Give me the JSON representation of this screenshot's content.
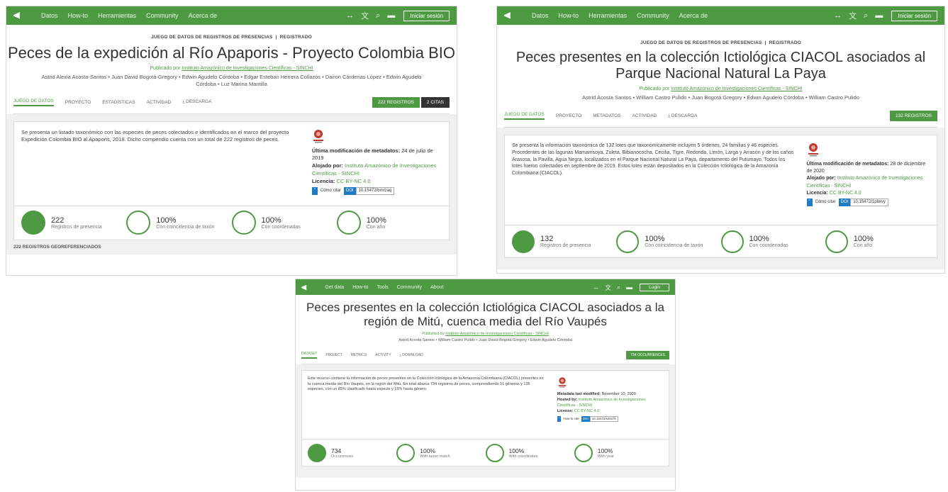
{
  "colors": {
    "brand_green": "#4e9a43",
    "doi_blue": "#1f7bc2"
  },
  "icons": [
    "bird-logo-icon",
    "pulse-icon",
    "translate-icon",
    "search-icon",
    "chat-icon",
    "download-icon",
    "institution-logo-icon"
  ],
  "p1": {
    "nav": [
      "Datos",
      "How-to",
      "Herramientas",
      "Community",
      "Acerca de"
    ],
    "login": "Iniciar sesión",
    "kicker": "JUEGO DE DATOS DE REGISTROS DE PRESENCIAS",
    "kicker2": "REGISTRADO",
    "title": "Peces de la expedición al Río Apaporis - Proyecto Colombia BIO",
    "published_by": "Publicado por",
    "publisher": "Instituto Amazónico de Investigaciones Científicas - SINCHI",
    "authors": "Astrid Alexia Acosta-Santos • Juan David Bogotá-Gregory • Edwin Agudelo Córdoba • Edgar Esteban Herrera Collazos • Dairon Cárdenas López • Edwin Agudelo Córdoba • Luz Marina Mantilla",
    "tabs": [
      "JUEGO DE DATOS",
      "PROYECTO",
      "ESTADÍSTICAS",
      "ACTIVIDAD",
      "DESCARGA"
    ],
    "btn_records_num": "222",
    "btn_records": "REGISTROS",
    "btn_cites": "2 CITAS",
    "description": "Se presenta un listado taxonómico con las especies de peces colectados e identificados en el marco del proyecto Expedición Colombia BIO al Apaporis, 2018. Dicho compendio cuenta con un total de 222 registros de peces.",
    "meta_mod_label": "Última modificación de metadatos:",
    "meta_mod_value": "24 de julio de 2019",
    "meta_host_label": "Alojado por:",
    "meta_host_value": "Instituto Amazónico de Investigaciones Científicas - SINCHI",
    "meta_lic_label": "Licencia:",
    "meta_lic_value": "CC BY-NC 4.0",
    "cite": "Cómo citar",
    "doi": "DOI",
    "doi_value": "10.15472/bmrzaq",
    "stats": [
      {
        "num": "222",
        "label": "Registros de presencia",
        "fraction": 1
      },
      {
        "num": "100%",
        "label": "Con coincidencia de taxón",
        "fraction": 0
      },
      {
        "num": "100%",
        "label": "Con coordenadas",
        "fraction": 0
      },
      {
        "num": "100%",
        "label": "Con año",
        "fraction": 0
      }
    ],
    "footer": "222 REGISTROS GEOREFERENCIADOS"
  },
  "p2": {
    "nav": [
      "Datos",
      "How-to",
      "Herramientas",
      "Community",
      "Acerca de"
    ],
    "login": "Iniciar sesión",
    "kicker": "JUEGO DE DATOS DE REGISTROS DE PRESENCIAS",
    "kicker2": "REGISTRADO",
    "title": "Peces presentes en la colección Ictiológica CIACOL asociados al Parque Nacional Natural La Paya",
    "published_by": "Publicado por",
    "publisher": "Instituto Amazónico de Investigaciones Científicas - SINCHI",
    "authors": "Astrid Acosta Santos • William Castro Pulido • Juan Bogotá Gregory • Edwin Agudelo Córdoba • William Castro Pulido",
    "tabs": [
      "JUEGO DE DATOS",
      "PROYECTO",
      "METADATOS",
      "ACTIVIDAD",
      "DESCARGA"
    ],
    "btn_records_num": "132",
    "btn_records": "REGISTROS",
    "description": "Se presenta la información taxonómica de 132 lotes que taxonómicamente incluyen 5 órdenes, 24 familias y 46 especies. Procedentes de las lagunas Mamamsoya, Zuleta, Bibianococha, Cecilia, Tigre, Redonda, Limón, Larga y Arrasón y de los caños Arasosa, la Pavilla, Agua Negra, localizados en el Parque Nacional Natural La Paya, departamento del Putumayo. Todos los lotes fueron colectados en septiembre de 2019. Estos lotes están depositados en la Colección Ictiológica de la Amazonía Colombiana (CIACOL).",
    "meta_mod_label": "Última modificación de metadatos:",
    "meta_mod_value": "28 de diciembre de 2020",
    "meta_host_label": "Alojado por:",
    "meta_host_value": "Instituto Amazónico de Investigaciones Científicas - SINCHI",
    "meta_lic_label": "Licencia:",
    "meta_lic_value": "CC BY-NC 4.0",
    "cite": "Cómo citar",
    "doi": "DOI",
    "doi_value": "10.15472/1pbxvy",
    "stats": [
      {
        "num": "132",
        "label": "Registros de presencia",
        "fraction": 1
      },
      {
        "num": "100%",
        "label": "Con coincidencia de taxón",
        "fraction": 0
      },
      {
        "num": "100%",
        "label": "Con coordenadas",
        "fraction": 0
      },
      {
        "num": "100%",
        "label": "Con año",
        "fraction": 0
      }
    ]
  },
  "p3": {
    "nav": [
      "Get data",
      "How-to",
      "Tools",
      "Community",
      "About"
    ],
    "login": "Login",
    "title": "Peces presentes en la colección Ictiológica CIACOL asociados a la región de Mitú, cuenca media del Río Vaupés",
    "published_by": "Published by",
    "publisher": "Instituto Amazónico de Investigaciones Científicas - SINCHI",
    "authors": "Astrid Acosta Santos • William Castro Pulido • Juan David Bogotá Gregory • Edwin Agudelo Córdoba",
    "tabs": [
      "DATASET",
      "PROJECT",
      "METRICS",
      "ACTIVITY",
      "DOWNLOAD"
    ],
    "btn_records_num": "734",
    "btn_records": "OCCURRENCES",
    "description": "Este recurso contiene la información de peces presentes en la Colección Ictiológica de la Amazonia Colombiana (CIACOL) presentes en la cuenca media del Río Vaupés, en la región del Mitú. En total abarca 734 registros de peces, comprendiendo 51 géneros y 135 especies, con un 85% clasificado hasta especie y 15% hasta género.",
    "meta_mod_label": "Metadata last modified:",
    "meta_mod_value": "November 10, 2020",
    "meta_host_label": "Hosted by:",
    "meta_host_value": "Instituto Amazónico de Investigaciones Científicas - SINCHI",
    "meta_lic_label": "License:",
    "meta_lic_value": "CC BY-NC 4.0",
    "cite": "How to cite",
    "doi": "DOI",
    "doi_value": "10.15472/s3ss7k",
    "stats": [
      {
        "num": "734",
        "label": "Occurrences",
        "fraction": 1
      },
      {
        "num": "100%",
        "label": "With taxon match",
        "fraction": 0
      },
      {
        "num": "100%",
        "label": "With coordinates",
        "fraction": 0
      },
      {
        "num": "100%",
        "label": "With year",
        "fraction": 0
      }
    ]
  }
}
